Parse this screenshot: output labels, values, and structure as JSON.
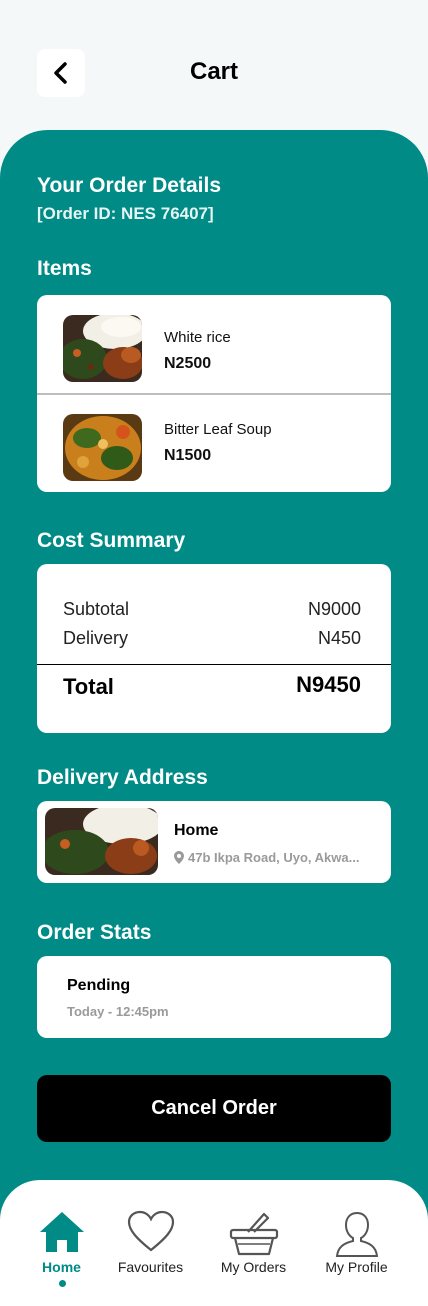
{
  "header": {
    "title": "Cart",
    "back_icon": "chevron-left-icon"
  },
  "order": {
    "heading": "Your Order Details",
    "order_id": "[Order ID: NES 76407]"
  },
  "items": {
    "heading": "Items",
    "list": [
      {
        "name": "White rice",
        "price": "N2500",
        "image": "rice-dish-thumbnail"
      },
      {
        "name": "Bitter Leaf Soup",
        "price": "N1500",
        "image": "soup-dish-thumbnail"
      }
    ]
  },
  "cost": {
    "heading": "Cost Summary",
    "subtotal_label": "Subtotal",
    "subtotal_value": "N9000",
    "delivery_label": "Delivery",
    "delivery_value": "N450",
    "total_label": "Total",
    "total_value": "N9450"
  },
  "address": {
    "heading": "Delivery Address",
    "name": "Home",
    "line": "47b Ikpa Road, Uyo, Akwa...",
    "icon": "location-pin-icon"
  },
  "stats": {
    "heading": "Order Stats",
    "status": "Pending",
    "time": "Today - 12:45pm"
  },
  "cancel_label": "Cancel Order",
  "nav": {
    "items": [
      {
        "label": "Home",
        "icon": "home-icon",
        "active": true
      },
      {
        "label": "Favourites",
        "icon": "heart-icon",
        "active": false
      },
      {
        "label": "My Orders",
        "icon": "basket-icon",
        "active": false
      },
      {
        "label": "My Profile",
        "icon": "person-icon",
        "active": false
      }
    ]
  },
  "colors": {
    "primary": "#008b87",
    "background": "#f4f8f8",
    "card": "#ffffff",
    "button": "#000000"
  }
}
